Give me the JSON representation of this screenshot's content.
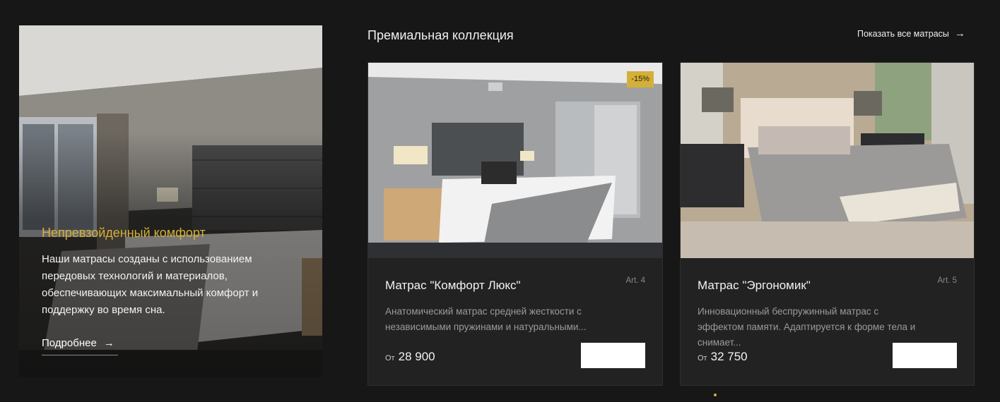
{
  "hero": {
    "title": "Непревзойденный комфорт",
    "description": "Наши матрасы созданы с использованием передовых технологий и материалов, обеспечивающих максимальный комфорт и поддержку во время сна.",
    "more_label": "Подробнее",
    "arrow": "→"
  },
  "section": {
    "title": "Премиальная коллекция",
    "show_all_label": "Показать все матрасы",
    "arrow": "→"
  },
  "products": [
    {
      "badge": "-15%",
      "name": "Матрас \"Комфорт Люкс\"",
      "art": "Art. 4",
      "description": "Анатомический матрас средней жесткости с независимыми пружинами и натуральными...",
      "price_prefix": "От",
      "price": "28 900"
    },
    {
      "name": "Матрас \"Эргономик\"",
      "art": "Art. 5",
      "description": "Инновационный беспружинный матрас с эффектом памяти. Адаптируется к форме тела и снимает...",
      "price_prefix": "От",
      "price": "32 750"
    }
  ],
  "colors": {
    "accent": "#d4b03a",
    "background": "#171717",
    "card": "#222222"
  }
}
